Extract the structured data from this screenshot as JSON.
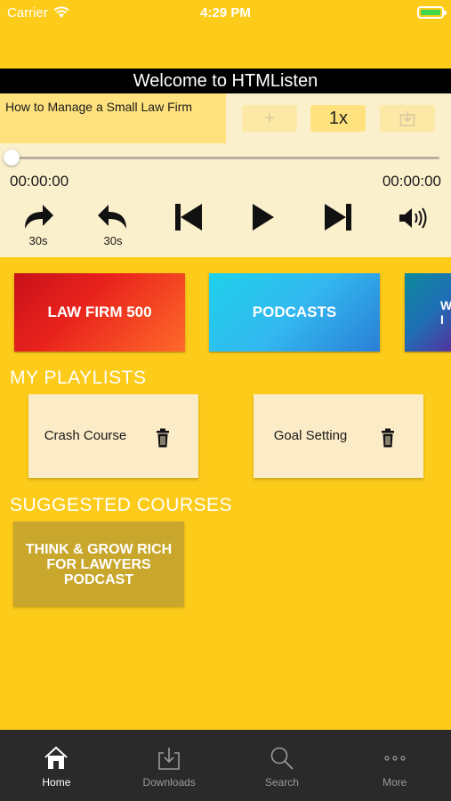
{
  "status_bar": {
    "carrier": "Carrier",
    "time": "4:29 PM",
    "battery_color": "#3ed84a"
  },
  "header": {
    "title": "Welcome to HTMListen"
  },
  "now_playing": {
    "title": "How to Manage a Small Law Firm",
    "speed": "1x",
    "add_icon": "plus-icon",
    "download_icon": "download-icon"
  },
  "player": {
    "elapsed": "00:00:00",
    "duration": "00:00:00",
    "progress": 0,
    "forward_label": "30s",
    "rewind_label": "30s"
  },
  "categories": [
    {
      "label": "LAW FIRM 500"
    },
    {
      "label": "PODCASTS"
    },
    {
      "label": "W I"
    }
  ],
  "playlists_section": {
    "title": "MY PLAYLISTS"
  },
  "playlists": [
    {
      "name": "Crash Course"
    },
    {
      "name": "Goal Setting"
    }
  ],
  "suggested_section": {
    "title": "SUGGESTED COURSES"
  },
  "courses": [
    {
      "title": "THINK & GROW RICH FOR LAWYERS PODCAST"
    }
  ],
  "tabs": [
    {
      "label": "Home",
      "icon": "home-icon",
      "active": true
    },
    {
      "label": "Downloads",
      "icon": "download-icon",
      "active": false
    },
    {
      "label": "Search",
      "icon": "search-icon",
      "active": false
    },
    {
      "label": "More",
      "icon": "more-icon",
      "active": false
    }
  ],
  "colors": {
    "background": "#FDCB1A",
    "panel": "#FBF0CC",
    "title_bar": "#000000",
    "tab_bar": "#2A2A2A"
  }
}
